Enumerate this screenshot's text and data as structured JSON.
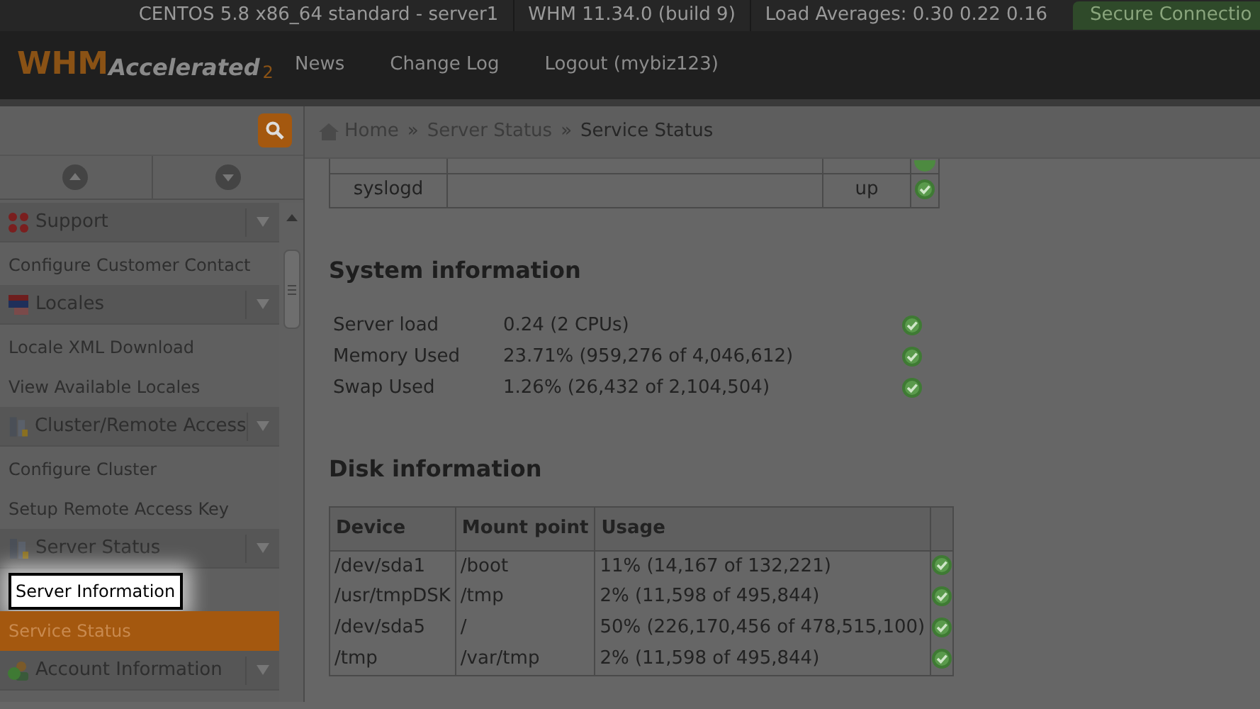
{
  "top_bar": {
    "items": [
      "CENTOS 5.8 x86_64 standard - server1",
      "WHM 11.34.0 (build 9)",
      "Load Averages: 0.30 0.22 0.16"
    ],
    "secure": "Secure Connectio"
  },
  "header": {
    "logo": "WHM",
    "logo_sub": "Accelerated",
    "logo_mark": "2",
    "nav": [
      "News",
      "Change Log",
      "Logout (mybiz123)"
    ]
  },
  "sidebar": {
    "groups": [
      {
        "title": "Support",
        "items": [
          {
            "label": "Configure Customer Contact",
            "selected": false,
            "highlighted": false
          }
        ]
      },
      {
        "title": "Locales",
        "items": [
          {
            "label": "Locale XML Download",
            "selected": false,
            "highlighted": false
          },
          {
            "label": "View Available Locales",
            "selected": false,
            "highlighted": false
          }
        ]
      },
      {
        "title": "Cluster/Remote Access",
        "items": [
          {
            "label": "Configure Cluster",
            "selected": false,
            "highlighted": false
          },
          {
            "label": "Setup Remote Access Key",
            "selected": false,
            "highlighted": false
          }
        ]
      },
      {
        "title": "Server Status",
        "items": [
          {
            "label": "Server Information",
            "selected": false,
            "highlighted": true
          },
          {
            "label": "Service Status",
            "selected": true,
            "highlighted": false
          }
        ]
      },
      {
        "title": "Account Information"
      }
    ]
  },
  "breadcrumb": [
    {
      "kind": "link",
      "text": "Home"
    },
    {
      "kind": "separator",
      "text": "»"
    },
    {
      "kind": "link",
      "text": "Server Status"
    },
    {
      "kind": "separator",
      "text": "»"
    },
    {
      "kind": "current",
      "text": "Service Status"
    }
  ],
  "service_rows": [
    {
      "service": "",
      "status": "",
      "ok": true
    },
    {
      "service": "syslogd",
      "status": "up",
      "ok": true
    }
  ],
  "system_information": {
    "title": "System information",
    "rows": [
      {
        "label": "Server load",
        "value": "0.24 (2 CPUs)",
        "ok": true
      },
      {
        "label": "Memory Used",
        "value": "23.71% (959,276 of 4,046,612)",
        "ok": true
      },
      {
        "label": "Swap Used",
        "value": "1.26% (26,432 of 2,104,504)",
        "ok": true
      }
    ]
  },
  "disk_information": {
    "title": "Disk information",
    "columns": [
      "Device",
      "Mount point",
      "Usage"
    ],
    "rows": [
      {
        "device": "/dev/sda1",
        "mount": "/boot",
        "usage": "11% (14,167 of 132,221)",
        "ok": true
      },
      {
        "device": "/usr/tmpDSK",
        "mount": "/tmp",
        "usage": "2% (11,598 of 495,844)",
        "ok": true
      },
      {
        "device": "/dev/sda5",
        "mount": "/",
        "usage": "50% (226,170,456 of 478,515,100)",
        "ok": true
      },
      {
        "device": "/tmp",
        "mount": "/var/tmp",
        "usage": "2% (11,598 of 495,844)",
        "ok": true
      }
    ]
  }
}
